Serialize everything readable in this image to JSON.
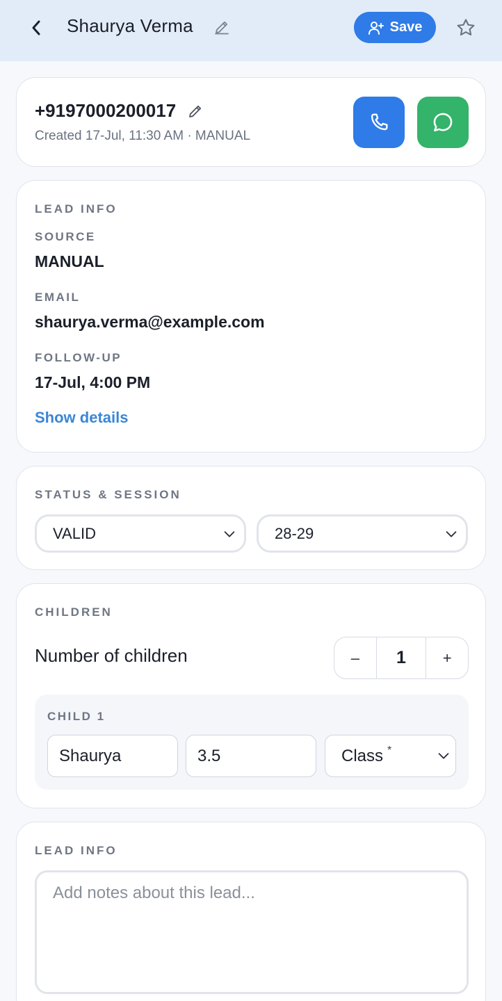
{
  "header": {
    "title": "Shaurya Verma",
    "save_label": "Save",
    "icons": [
      "chevron-left-icon",
      "pencil-icon",
      "user-plus-icon",
      "star-icon"
    ]
  },
  "contact": {
    "phone": "+9197000200017",
    "created": "Created 17-Jul, 11:30 AM · MANUAL",
    "call_color": "#2f7be8",
    "whatsapp_color": "#34b36a"
  },
  "lead_info": {
    "section_label": "LEAD INFO",
    "source_label": "SOURCE",
    "source_value": "MANUAL",
    "email_label": "EMAIL",
    "email_value": "shaurya.verma@example.com",
    "followup_label": "FOLLOW-UP",
    "followup_value": "17-Jul, 4:00 PM",
    "show_details": "Show details"
  },
  "status_session": {
    "section_label": "STATUS & SESSION",
    "status_value": "VALID",
    "session_value": "28-29"
  },
  "children": {
    "section_label": "CHILDREN",
    "count_label": "Number of children",
    "count": "1",
    "minus": "–",
    "plus": "+",
    "child_title": "CHILD 1",
    "child_name": "Shaurya",
    "child_age": "3.5",
    "class_placeholder": "Class",
    "class_required": "*"
  },
  "notes": {
    "section_label": "LEAD INFO",
    "placeholder": "Add notes about this lead..."
  },
  "colors": {
    "accent": "#2f7be8",
    "link": "#3a86d6",
    "header_bg": "#e2ecf8"
  }
}
